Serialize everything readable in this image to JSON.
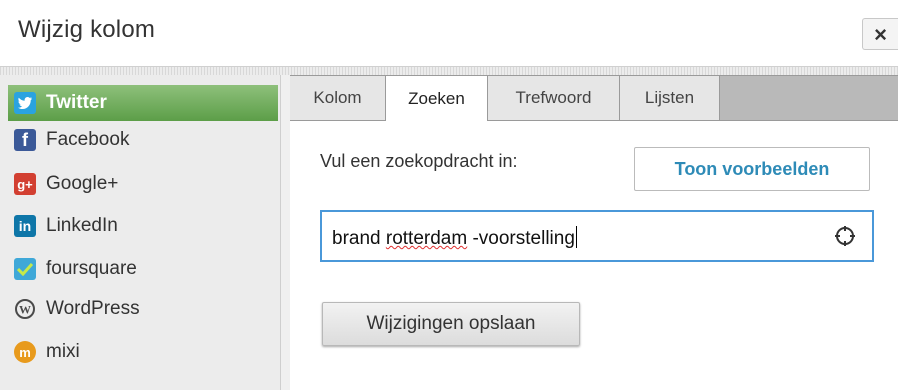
{
  "dialog": {
    "title": "Wijzig kolom",
    "close_label": "×"
  },
  "sidebar": {
    "items": [
      {
        "label": "Twitter",
        "icon": "twitter-icon",
        "color": "#2aa3e0",
        "active": true
      },
      {
        "label": "Facebook",
        "icon": "facebook-icon",
        "color": "#3b5998",
        "active": false
      },
      {
        "label": "Google+",
        "icon": "google-plus-icon",
        "color": "#d23f31",
        "active": false
      },
      {
        "label": "LinkedIn",
        "icon": "linkedin-icon",
        "color": "#0e76a8",
        "active": false
      },
      {
        "label": "foursquare",
        "icon": "foursquare-icon",
        "color": "#3fa8d8",
        "active": false
      },
      {
        "label": "WordPress",
        "icon": "wordpress-icon",
        "color": "#4a4a4a",
        "active": false
      },
      {
        "label": "mixi",
        "icon": "mixi-icon",
        "color": "#e89a1c",
        "active": false
      }
    ],
    "active_color": "#6aa854"
  },
  "tabs": [
    {
      "label": "Kolom",
      "active": false
    },
    {
      "label": "Zoeken",
      "active": true
    },
    {
      "label": "Trefwoord",
      "active": false
    },
    {
      "label": "Lijsten",
      "active": false
    }
  ],
  "search": {
    "prompt": "Vul een zoekopdracht in:",
    "examples_button": "Toon voorbeelden",
    "query_part1": "brand ",
    "query_part2": "rotterdam",
    "query_part3": " -voorstelling",
    "accent_color": "#4a98d9"
  },
  "actions": {
    "save_label": "Wijzigingen opslaan"
  }
}
